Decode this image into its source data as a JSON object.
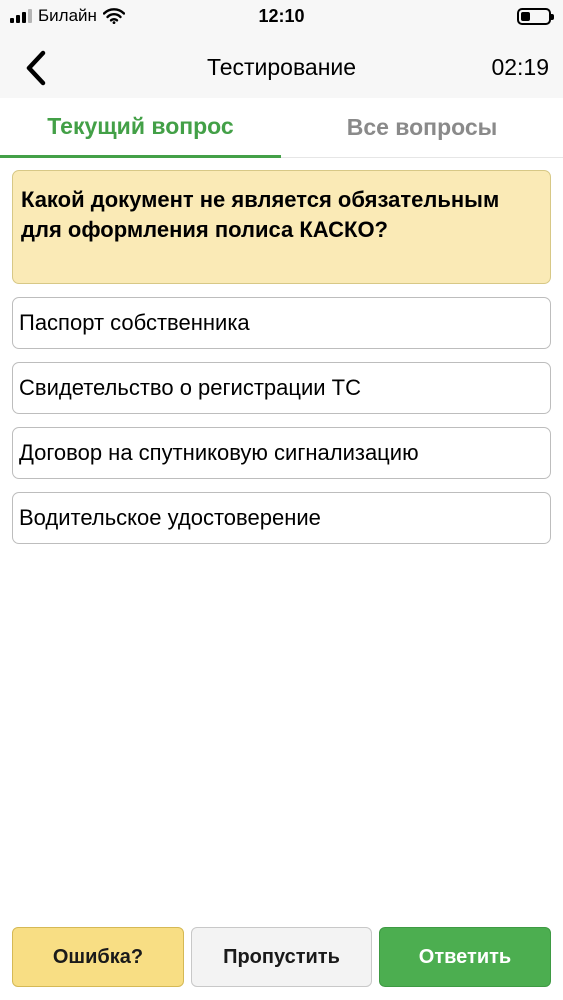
{
  "status_bar": {
    "carrier": "Билайн",
    "time": "12:10",
    "battery_level": 0.35
  },
  "nav": {
    "back_icon": "chevron-left-icon",
    "title": "Тестирование",
    "timer": "02:19"
  },
  "tabs": [
    {
      "label": "Текущий вопрос",
      "active": true
    },
    {
      "label": "Все вопросы",
      "active": false
    }
  ],
  "question": {
    "text": "Какой документ не является обязательным для оформления полиса КАСКО?"
  },
  "answers": [
    {
      "label": "Паспорт собственника"
    },
    {
      "label": "Свидетельство о регистрации ТС"
    },
    {
      "label": "Договор на спутниковую сигнализацию"
    },
    {
      "label": "Водительское удостоверение"
    }
  ],
  "buttons": {
    "error_label": "Ошибка?",
    "skip_label": "Пропустить",
    "answer_label": "Ответить"
  },
  "colors": {
    "accent_green": "#43a047",
    "question_bg": "#faeab6",
    "error_button_bg": "#f8de84",
    "answer_button_bg": "#4cae50"
  }
}
